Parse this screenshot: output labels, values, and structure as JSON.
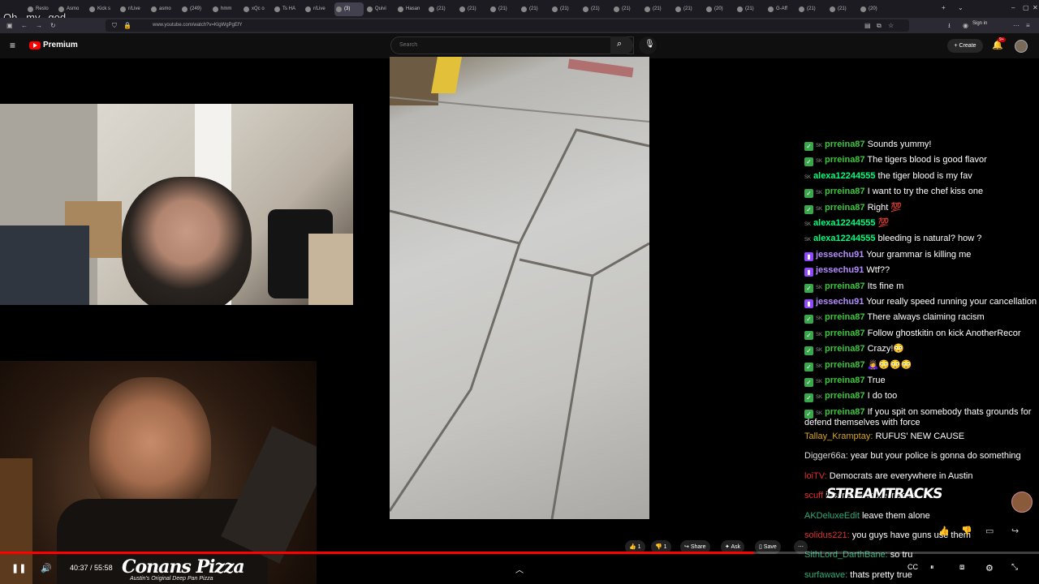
{
  "browser": {
    "tabs": [
      {
        "label": "Resto"
      },
      {
        "label": "Asmo"
      },
      {
        "label": "Kick s"
      },
      {
        "label": "r/Live"
      },
      {
        "label": "asmo"
      },
      {
        "label": "(249)"
      },
      {
        "label": "hmm"
      },
      {
        "label": "xQc o"
      },
      {
        "label": "Ts HA"
      },
      {
        "label": "r/Live"
      },
      {
        "label": "(3)"
      },
      {
        "label": "Quivi"
      },
      {
        "label": "Hasan"
      },
      {
        "label": "(21)"
      },
      {
        "label": "(21)"
      },
      {
        "label": "(21)"
      },
      {
        "label": "(21)"
      },
      {
        "label": "(21)"
      },
      {
        "label": "(21)"
      },
      {
        "label": "(21)"
      },
      {
        "label": "(21)"
      },
      {
        "label": "(21)"
      },
      {
        "label": "(20)"
      },
      {
        "label": "(21)"
      },
      {
        "label": "G-Aff"
      },
      {
        "label": "(21)"
      },
      {
        "label": "(21)"
      },
      {
        "label": "(20)"
      }
    ],
    "url": "www.youtube.com/watch?v=KlgWgPgEfY",
    "sign_in": "Sign in",
    "overlay_caption": "Oh.. my.. god..."
  },
  "youtube": {
    "brand": "Premium",
    "search_placeholder": "Search",
    "create_label": "Create",
    "notification_count": "9+"
  },
  "chat": {
    "messages": [
      {
        "badge": "check",
        "sub": "SK",
        "user": "prreina87",
        "color": "green",
        "text": "Sounds yummy!"
      },
      {
        "badge": "check",
        "sub": "SK",
        "user": "prreina87",
        "color": "green",
        "text": "The tigers blood is good flavor"
      },
      {
        "badge": "none",
        "sub": "SK",
        "user": "alexa12244555",
        "color": "lime",
        "text": "the tiger blood is my fav"
      },
      {
        "badge": "check",
        "sub": "SK",
        "user": "prreina87",
        "color": "green",
        "text": "I want to try the chef kiss one"
      },
      {
        "badge": "check",
        "sub": "SK",
        "user": "prreina87",
        "color": "green",
        "text": "Right 💯"
      },
      {
        "badge": "none",
        "sub": "SK",
        "user": "alexa12244555",
        "color": "lime",
        "text": "💯"
      },
      {
        "badge": "none",
        "sub": "SK",
        "user": "alexa12244555",
        "color": "lime",
        "text": "bleeding is natural? how ?"
      },
      {
        "badge": "twitch",
        "sub": "",
        "user": "jessechu91",
        "color": "purple",
        "text": "Your grammar is killing me"
      },
      {
        "badge": "twitch",
        "sub": "",
        "user": "jessechu91",
        "color": "purple",
        "text": "Wtf??"
      },
      {
        "badge": "check",
        "sub": "SK",
        "user": "prreina87",
        "color": "green",
        "text": "Its fine m"
      },
      {
        "badge": "twitch",
        "sub": "",
        "user": "jessechu91",
        "color": "purple",
        "text": "Your really speed running your cancellation"
      },
      {
        "badge": "check",
        "sub": "SK",
        "user": "prreina87",
        "color": "green",
        "text": "There always claiming racism"
      },
      {
        "badge": "check",
        "sub": "SK",
        "user": "prreina87",
        "color": "green",
        "text": "Follow ghostkitin on kick AnotherRecor"
      },
      {
        "badge": "check",
        "sub": "SK",
        "user": "prreina87",
        "color": "green",
        "text": "Crazy!😳"
      },
      {
        "badge": "check",
        "sub": "SK",
        "user": "prreina87",
        "color": "green",
        "text": "🙇‍♀️😳😳😳"
      },
      {
        "badge": "check",
        "sub": "SK",
        "user": "prreina87",
        "color": "green",
        "text": "True"
      },
      {
        "badge": "check",
        "sub": "SK",
        "user": "prreina87",
        "color": "green",
        "text": "I do too"
      },
      {
        "badge": "check",
        "sub": "SK",
        "user": "prreina87",
        "color": "green",
        "text": "If you spit on somebody thats grounds for"
      }
    ],
    "wrap_line": "defend themselves with force",
    "messages2": [
      {
        "user": "Tallay_Kramptay:",
        "color": "gold",
        "text": "RUFUS' NEW CAUSE"
      },
      {
        "user": "Digger66a:",
        "color": "white",
        "text": "year but your police is gonna do something"
      },
      {
        "user": "loiTV:",
        "color": "red",
        "text": "Democrats are everywhere in Austin"
      },
      {
        "user": "scuff",
        "color": "red",
        "text": "insane be more insane"
      },
      {
        "user": "AKDeluxeEdit",
        "color": "teal",
        "text": "leave them alone"
      },
      {
        "user": "solidus221:",
        "color": "red",
        "text": "you guys have guns use them"
      },
      {
        "user": "SithLord_DarthBane:",
        "color": "teal",
        "text": "so tru"
      },
      {
        "user": "surfawave:",
        "color": "teal",
        "text": "thats pretty true"
      }
    ],
    "watermark": "STREAMTRACKS"
  },
  "player": {
    "time_current": "40:37",
    "time_total": "55:58",
    "progress": 0.726,
    "like_count": "1",
    "dislike_count": "1",
    "share_label": "Share",
    "ask_label": "Ask",
    "save_label": "Save"
  },
  "overlay": {
    "pizza_brand": "Conans Pizza",
    "pizza_tagline": "Austin's Original Deep Pan Pizza"
  },
  "colors": {
    "youtube_red": "#ff0000",
    "background": "#0f0f0f"
  }
}
